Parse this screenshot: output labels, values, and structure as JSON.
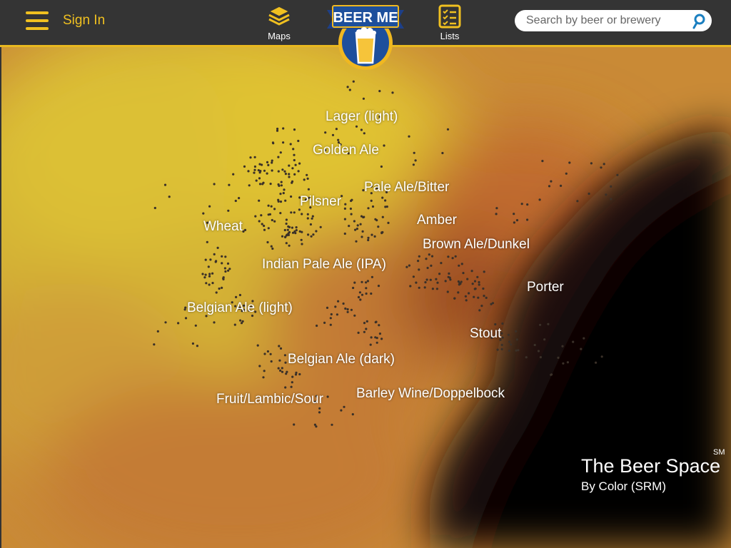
{
  "header": {
    "sign_in": "Sign In",
    "maps_label": "Maps",
    "lists_label": "Lists",
    "logo_text": "BEER ME",
    "search_placeholder": "Search by beer or brewery"
  },
  "map": {
    "style_labels": [
      "Lager (light)",
      "Golden Ale",
      "Pale Ale/Bitter",
      "Pilsner",
      "Wheat",
      "Amber",
      "Brown Ale/Dunkel",
      "Indian Pale Ale (IPA)",
      "Porter",
      "Belgian Ale (light)",
      "Stout",
      "Belgian Ale (dark)",
      "Barley Wine/Doppelbock",
      "Fruit/Lambic/Sour"
    ],
    "title": "The Beer Space",
    "title_mark": "SM",
    "subtitle": "By Color (SRM)"
  },
  "colors": {
    "header_bg": "#343434",
    "accent": "#f0c020",
    "light_beer": "#e0c030",
    "amber": "#c87838",
    "dark": "#0a0504"
  }
}
